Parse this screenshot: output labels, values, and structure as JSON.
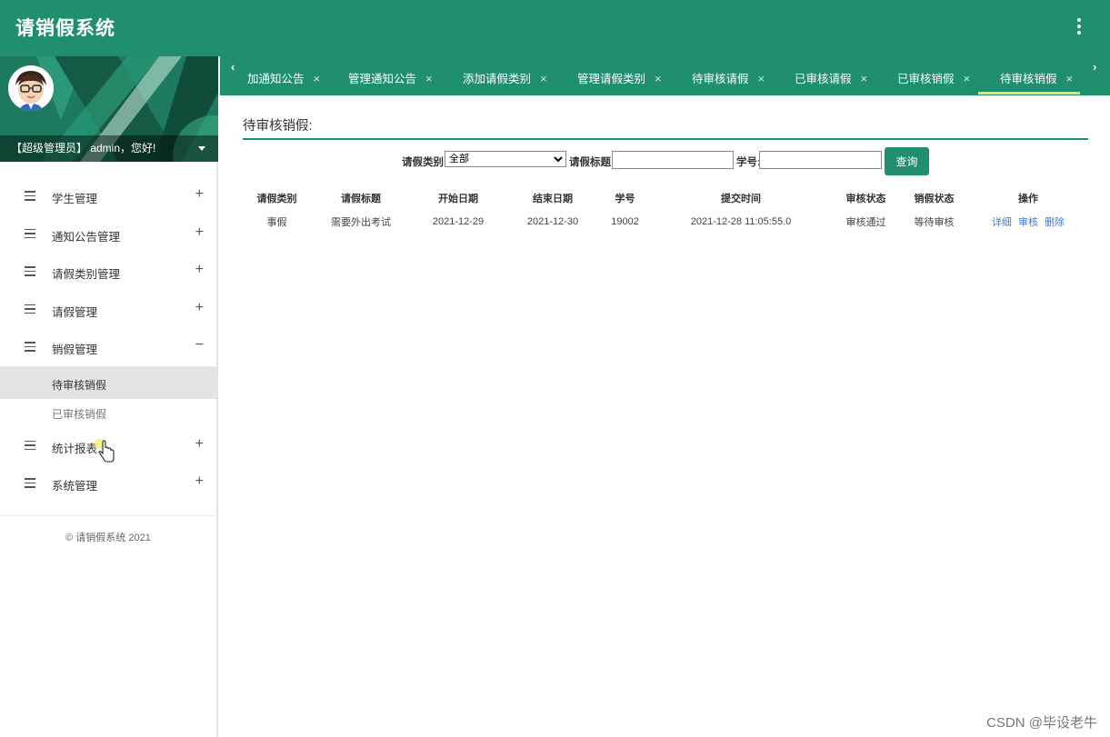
{
  "app": {
    "title": "请销假系统"
  },
  "user": {
    "greeting": "【超级管理员】 admin，您好!"
  },
  "sidebar": {
    "items": [
      {
        "label": "学生管理",
        "sign": "+"
      },
      {
        "label": "通知公告管理",
        "sign": "+"
      },
      {
        "label": "请假类别管理",
        "sign": "+"
      },
      {
        "label": "请假管理",
        "sign": "+"
      },
      {
        "label": "销假管理",
        "sign": "−"
      },
      {
        "label": "统计报表",
        "sign": "+"
      },
      {
        "label": "系统管理",
        "sign": "+"
      }
    ],
    "subitems": [
      {
        "label": "待审核销假"
      },
      {
        "label": "已审核销假"
      }
    ],
    "copyright": "© 请销假系统 2021"
  },
  "tabs": [
    {
      "label": "加通知公告"
    },
    {
      "label": "管理通知公告"
    },
    {
      "label": "添加请假类别"
    },
    {
      "label": "管理请假类别"
    },
    {
      "label": "待审核请假"
    },
    {
      "label": "已审核请假"
    },
    {
      "label": "已审核销假"
    },
    {
      "label": "待审核销假"
    }
  ],
  "tab_close": "×",
  "main": {
    "title": "待审核销假:",
    "search": {
      "category_label": "请假类别:",
      "category_value": "全部",
      "title_label": "请假标题:",
      "title_value": "",
      "student_label": "学号:",
      "student_value": "",
      "query_button": "查询"
    },
    "table": {
      "headers": [
        "请假类别",
        "请假标题",
        "开始日期",
        "结束日期",
        "学号",
        "提交时间",
        "审核状态",
        "销假状态",
        "操作"
      ],
      "rows": [
        {
          "category": "事假",
          "title": "需要外出考试",
          "start": "2021-12-29",
          "end": "2021-12-30",
          "student_no": "19002",
          "submitted": "2021-12-28 11:05:55.0",
          "review_status": "审核通过",
          "cancel_status": "等待审核",
          "ops": [
            "详细",
            "审核",
            "删除"
          ]
        }
      ]
    }
  },
  "watermark": "CSDN @毕设老牛",
  "colors": {
    "primary": "#1f8f6e",
    "link": "#3e7bd6",
    "tab_indicator": "#e8e06a"
  },
  "icons": {
    "menu": "hamburger-icon",
    "kebab": "more-vert-icon",
    "cursor": "hand-pointer-icon"
  }
}
